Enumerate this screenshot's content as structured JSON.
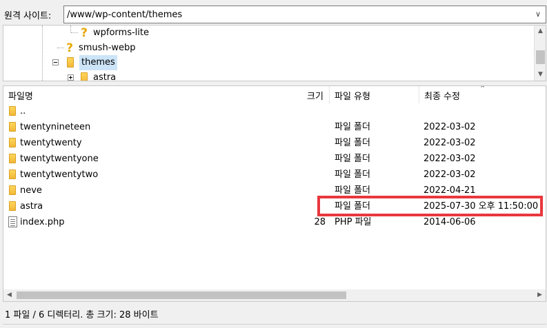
{
  "address_bar": {
    "label": "원격 사이트:",
    "path": "/www/wp-content/themes"
  },
  "tree": {
    "items": [
      {
        "label": "wpforms-lite",
        "icon": "question-icon"
      },
      {
        "label": "smush-webp",
        "icon": "question-icon"
      },
      {
        "label": "themes",
        "icon": "folder-icon"
      },
      {
        "label": "astra",
        "icon": "folder-icon"
      }
    ]
  },
  "file_list": {
    "columns": {
      "name": "파일명",
      "size": "크기",
      "type": "파일 유형",
      "modified": "최종 수정"
    },
    "rows": [
      {
        "name": "..",
        "size": "",
        "type": "",
        "modified": "",
        "icon": "folder-icon"
      },
      {
        "name": "twentynineteen",
        "size": "",
        "type": "파일 폴더",
        "modified": "2022-03-02",
        "icon": "folder-icon"
      },
      {
        "name": "twentytwenty",
        "size": "",
        "type": "파일 폴더",
        "modified": "2022-03-02",
        "icon": "folder-icon"
      },
      {
        "name": "twentytwentyone",
        "size": "",
        "type": "파일 폴더",
        "modified": "2022-03-02",
        "icon": "folder-icon"
      },
      {
        "name": "twentytwentytwo",
        "size": "",
        "type": "파일 폴더",
        "modified": "2022-03-02",
        "icon": "folder-icon"
      },
      {
        "name": "neve",
        "size": "",
        "type": "파일 폴더",
        "modified": "2022-04-21",
        "icon": "folder-icon"
      },
      {
        "name": "astra",
        "size": "",
        "type": "파일 폴더",
        "modified": "2025-07-30 오후 11:50:00",
        "icon": "folder-icon"
      },
      {
        "name": "index.php",
        "size": "28",
        "type": "PHP 파일",
        "modified": "2014-06-06",
        "icon": "file-icon"
      }
    ]
  },
  "status": {
    "text": "1 파일 / 6 디렉터리. 총 크기: 28 바이트"
  },
  "colors": {
    "highlight_border": "#e8383d",
    "selection": "#cce4f7",
    "folder": "#f3b838"
  }
}
